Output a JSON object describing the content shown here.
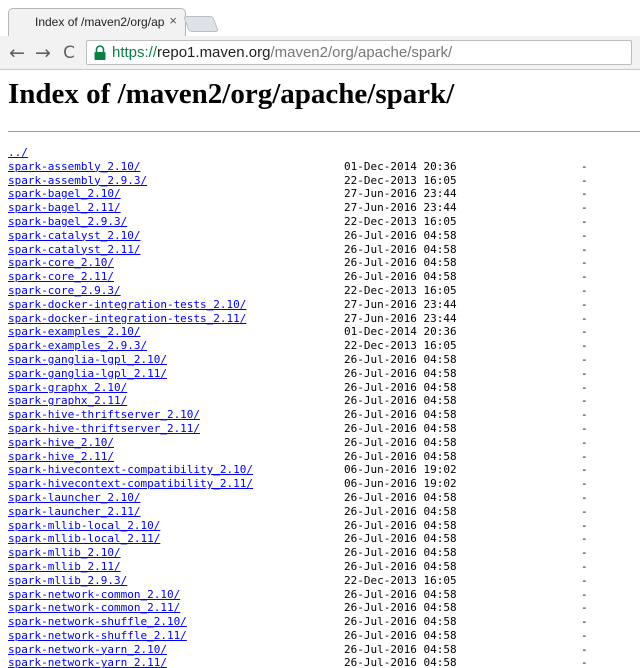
{
  "browser": {
    "tab_title": "Index of /maven2/org/apa",
    "tab_close": "×",
    "url_scheme": "https://",
    "url_host": "repo1.maven.org",
    "url_path": "/maven2/org/apache/spark/",
    "back_glyph": "←",
    "forward_glyph": "→",
    "reload_glyph": "C"
  },
  "page": {
    "title": "Index of /maven2/org/apache/spark/",
    "parent_link": "../",
    "entries": [
      {
        "name": "spark-assembly_2.10/",
        "date": "01-Dec-2014 20:36",
        "size": "-"
      },
      {
        "name": "spark-assembly_2.9.3/",
        "date": "22-Dec-2013 16:05",
        "size": "-"
      },
      {
        "name": "spark-bagel_2.10/",
        "date": "27-Jun-2016 23:44",
        "size": "-"
      },
      {
        "name": "spark-bagel_2.11/",
        "date": "27-Jun-2016 23:44",
        "size": "-"
      },
      {
        "name": "spark-bagel_2.9.3/",
        "date": "22-Dec-2013 16:05",
        "size": "-"
      },
      {
        "name": "spark-catalyst_2.10/",
        "date": "26-Jul-2016 04:58",
        "size": "-"
      },
      {
        "name": "spark-catalyst_2.11/",
        "date": "26-Jul-2016 04:58",
        "size": "-"
      },
      {
        "name": "spark-core_2.10/",
        "date": "26-Jul-2016 04:58",
        "size": "-"
      },
      {
        "name": "spark-core_2.11/",
        "date": "26-Jul-2016 04:58",
        "size": "-"
      },
      {
        "name": "spark-core_2.9.3/",
        "date": "22-Dec-2013 16:05",
        "size": "-"
      },
      {
        "name": "spark-docker-integration-tests_2.10/",
        "date": "27-Jun-2016 23:44",
        "size": "-"
      },
      {
        "name": "spark-docker-integration-tests_2.11/",
        "date": "27-Jun-2016 23:44",
        "size": "-"
      },
      {
        "name": "spark-examples_2.10/",
        "date": "01-Dec-2014 20:36",
        "size": "-"
      },
      {
        "name": "spark-examples_2.9.3/",
        "date": "22-Dec-2013 16:05",
        "size": "-"
      },
      {
        "name": "spark-ganglia-lgpl_2.10/",
        "date": "26-Jul-2016 04:58",
        "size": "-"
      },
      {
        "name": "spark-ganglia-lgpl_2.11/",
        "date": "26-Jul-2016 04:58",
        "size": "-"
      },
      {
        "name": "spark-graphx_2.10/",
        "date": "26-Jul-2016 04:58",
        "size": "-"
      },
      {
        "name": "spark-graphx_2.11/",
        "date": "26-Jul-2016 04:58",
        "size": "-"
      },
      {
        "name": "spark-hive-thriftserver_2.10/",
        "date": "26-Jul-2016 04:58",
        "size": "-"
      },
      {
        "name": "spark-hive-thriftserver_2.11/",
        "date": "26-Jul-2016 04:58",
        "size": "-"
      },
      {
        "name": "spark-hive_2.10/",
        "date": "26-Jul-2016 04:58",
        "size": "-"
      },
      {
        "name": "spark-hive_2.11/",
        "date": "26-Jul-2016 04:58",
        "size": "-"
      },
      {
        "name": "spark-hivecontext-compatibility_2.10/",
        "date": "06-Jun-2016 19:02",
        "size": "-"
      },
      {
        "name": "spark-hivecontext-compatibility_2.11/",
        "date": "06-Jun-2016 19:02",
        "size": "-"
      },
      {
        "name": "spark-launcher_2.10/",
        "date": "26-Jul-2016 04:58",
        "size": "-"
      },
      {
        "name": "spark-launcher_2.11/",
        "date": "26-Jul-2016 04:58",
        "size": "-"
      },
      {
        "name": "spark-mllib-local_2.10/",
        "date": "26-Jul-2016 04:58",
        "size": "-"
      },
      {
        "name": "spark-mllib-local_2.11/",
        "date": "26-Jul-2016 04:58",
        "size": "-"
      },
      {
        "name": "spark-mllib_2.10/",
        "date": "26-Jul-2016 04:58",
        "size": "-"
      },
      {
        "name": "spark-mllib_2.11/",
        "date": "26-Jul-2016 04:58",
        "size": "-"
      },
      {
        "name": "spark-mllib_2.9.3/",
        "date": "22-Dec-2013 16:05",
        "size": "-"
      },
      {
        "name": "spark-network-common_2.10/",
        "date": "26-Jul-2016 04:58",
        "size": "-"
      },
      {
        "name": "spark-network-common_2.11/",
        "date": "26-Jul-2016 04:58",
        "size": "-"
      },
      {
        "name": "spark-network-shuffle_2.10/",
        "date": "26-Jul-2016 04:58",
        "size": "-"
      },
      {
        "name": "spark-network-shuffle_2.11/",
        "date": "26-Jul-2016 04:58",
        "size": "-"
      },
      {
        "name": "spark-network-yarn_2.10/",
        "date": "26-Jul-2016 04:58",
        "size": "-"
      },
      {
        "name": "spark-network-yarn_2.11/",
        "date": "26-Jul-2016 04:58",
        "size": "-"
      }
    ]
  },
  "colors": {
    "link": "#0000ee",
    "secure_scheme": "#0b8043",
    "lock": "#0b8043"
  },
  "icons": {
    "lock": "lock-icon",
    "back": "back-arrow-icon",
    "forward": "forward-arrow-icon",
    "reload": "reload-icon",
    "close": "close-icon"
  }
}
